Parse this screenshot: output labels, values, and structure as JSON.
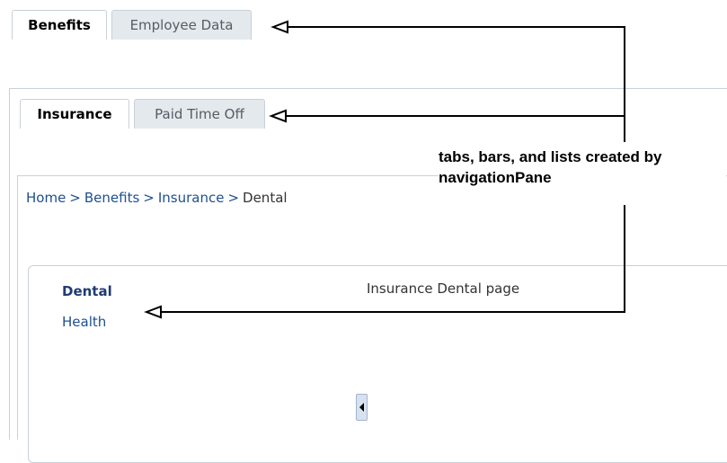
{
  "top_tabs": [
    {
      "label": "Benefits",
      "selected": true
    },
    {
      "label": "Employee Data",
      "selected": false
    }
  ],
  "sub_tabs": [
    {
      "label": "Insurance",
      "selected": true
    },
    {
      "label": "Paid Time Off",
      "selected": false
    }
  ],
  "breadcrumb": {
    "separator": ">",
    "items": [
      "Home",
      "Benefits",
      "Insurance"
    ],
    "current": "Dental"
  },
  "list": {
    "items": [
      {
        "label": "Dental",
        "selected": true
      },
      {
        "label": "Health",
        "selected": false
      }
    ]
  },
  "content": {
    "text": "Insurance Dental page"
  },
  "callout": {
    "line1": "tabs, bars, and lists created by",
    "line2": "navigationPane"
  },
  "colors": {
    "border": "#c9d0d8",
    "tab_unselected_bg": "#e4e9ee",
    "link": "#1f4f8f",
    "selected_link": "#1f3b73"
  },
  "icons": {
    "callout_arrows": "arrow-left-icon",
    "splitter": "collapse-left-icon"
  }
}
